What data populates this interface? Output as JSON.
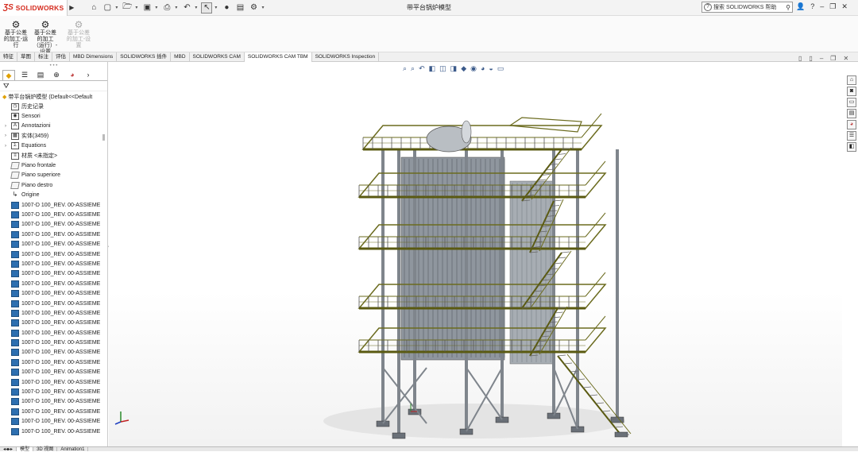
{
  "app": {
    "logo_text": "SOLIDWORKS",
    "document_title": "带平台锅炉模型",
    "help_search_placeholder": "搜索 SOLIDWORKS 帮助",
    "help_search_icon": "search-icon",
    "window_buttons": [
      "minimize-icon",
      "restore-icon",
      "close-icon"
    ]
  },
  "quick_access": {
    "icons": [
      "home-icon",
      "new-icon",
      "open-icon",
      "save-icon",
      "print-icon",
      "undo-icon",
      "select-icon",
      "rebuild-icon",
      "options-icon",
      "settings-icon"
    ]
  },
  "ribbon": {
    "buttons": [
      {
        "label": "基于公差的加工-运行",
        "enabled": true
      },
      {
        "label": "基于公差的加工（运行）-设置",
        "enabled": true
      },
      {
        "label": "基于公差的加工-设置",
        "enabled": false
      }
    ]
  },
  "command_tabs": [
    "特征",
    "草图",
    "标注",
    "评估",
    "MBD Dimensions",
    "SOLIDWORKS 插件",
    "MBD",
    "SOLIDWORKS CAM",
    "SOLIDWORKS CAM TBM",
    "SOLIDWORKS Inspection"
  ],
  "active_command_tab": "SOLIDWORKS CAM TBM",
  "feature_tree": {
    "root": "带平台锅炉模型 (Default<<Default",
    "nodes": [
      {
        "label": "历史记录",
        "icon": "history-icon",
        "expandable": false
      },
      {
        "label": "Sensori",
        "icon": "sensor-icon",
        "expandable": false
      },
      {
        "label": "Annotazioni",
        "icon": "annotation-icon",
        "expandable": true
      },
      {
        "label": "实体(3459)",
        "icon": "solid-bodies-icon",
        "expandable": true
      },
      {
        "label": "Equations",
        "icon": "equations-icon",
        "expandable": true
      },
      {
        "label": "材质 <未指定>",
        "icon": "material-icon",
        "expandable": false
      },
      {
        "label": "Piano frontale",
        "icon": "plane-icon",
        "expandable": false
      },
      {
        "label": "Piano superiore",
        "icon": "plane-icon",
        "expandable": false
      },
      {
        "label": "Piano destro",
        "icon": "plane-icon",
        "expandable": false
      },
      {
        "label": "Origine",
        "icon": "origin-icon",
        "expandable": false
      }
    ],
    "parts": [
      "1007-D 100_REV. 00-ASSIEME",
      "1007-D 100_REV. 00-ASSIEME",
      "1007-D 100_REV. 00-ASSIEME",
      "1007-D 100_REV. 00-ASSIEME",
      "1007-D 100_REV. 00-ASSIEME",
      "1007-D 100_REV. 00-ASSIEME",
      "1007-D 100_REV. 00-ASSIEME",
      "1007-D 100_REV. 00-ASSIEME",
      "1007-D 100_REV. 00-ASSIEME",
      "1007-D 100_REV. 00-ASSIEME",
      "1007-D 100_REV. 00-ASSIEME",
      "1007-D 100_REV. 00-ASSIEME",
      "1007-D 100_REV. 00-ASSIEME",
      "1007-D 100_REV. 00-ASSIEME",
      "1007-D 100_REV. 00-ASSIEME",
      "1007-D 100_REV. 00-ASSIEME",
      "1007-D 100_REV. 00-ASSIEME",
      "1007-D 100_REV. 00-ASSIEME",
      "1007-D 100_REV. 00-ASSIEME",
      "1007-D 100_REV. 00-ASSIEME",
      "1007-D 100_REV. 00-ASSIEME",
      "1007-D 100_REV. 00-ASSIEME",
      "1007-D 100_REV. 00-ASSIEME",
      "1007-D 100_REV. 00-ASSIEME"
    ]
  },
  "bottom_tabs": [
    "模型",
    "3D 视图",
    "Animation1"
  ],
  "colors": {
    "accent": "#d52b1e",
    "structure": "#8a8f95",
    "handrail": "#6b6b1e",
    "boiler": "#7d8590"
  }
}
